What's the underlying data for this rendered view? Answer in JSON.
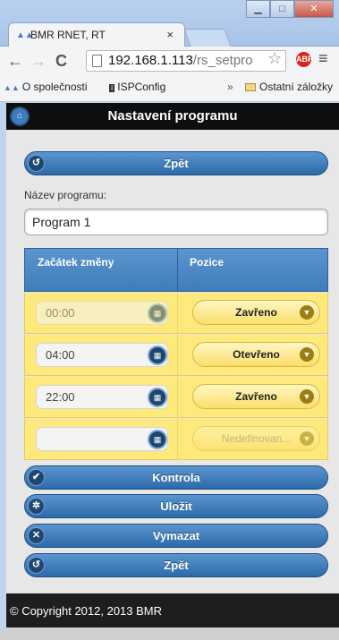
{
  "browser": {
    "tab_title": "BMR RNET, RT",
    "tab_close": "×",
    "url_host": "192.168.1.113",
    "url_path": "/rs_setpro",
    "bookmarks": [
      {
        "label": "O společnosti"
      },
      {
        "label": "ISPConfig"
      }
    ],
    "bookmarks_overflow": "»",
    "other_bookmarks": "Ostatní záložky"
  },
  "header": {
    "title": "Nastavení programu"
  },
  "back_top": {
    "label": "Zpět"
  },
  "program": {
    "label": "Název programu:",
    "value": "Program  1"
  },
  "table": {
    "col_start": "Začátek změny",
    "col_position": "Pozice",
    "rows": [
      {
        "time": "00:00",
        "position": "Zavřeno",
        "dim_time": true,
        "dim_pos": false
      },
      {
        "time": "04:00",
        "position": "Otevřeno",
        "dim_time": false,
        "dim_pos": false
      },
      {
        "time": "22:00",
        "position": "Zavřeno",
        "dim_time": false,
        "dim_pos": false
      },
      {
        "time": "",
        "position": "Nedefinovan...",
        "dim_time": false,
        "dim_pos": true
      }
    ]
  },
  "actions": {
    "check": "Kontrola",
    "save": "Uložit",
    "delete": "Vymazat",
    "back": "Zpět"
  },
  "footer": {
    "text": "© Copyright 2012, 2013 BMR"
  },
  "colors": {
    "button_blue": "#3f7cbb",
    "row_yellow": "#fde97c",
    "header_black": "#0e0e0e"
  }
}
